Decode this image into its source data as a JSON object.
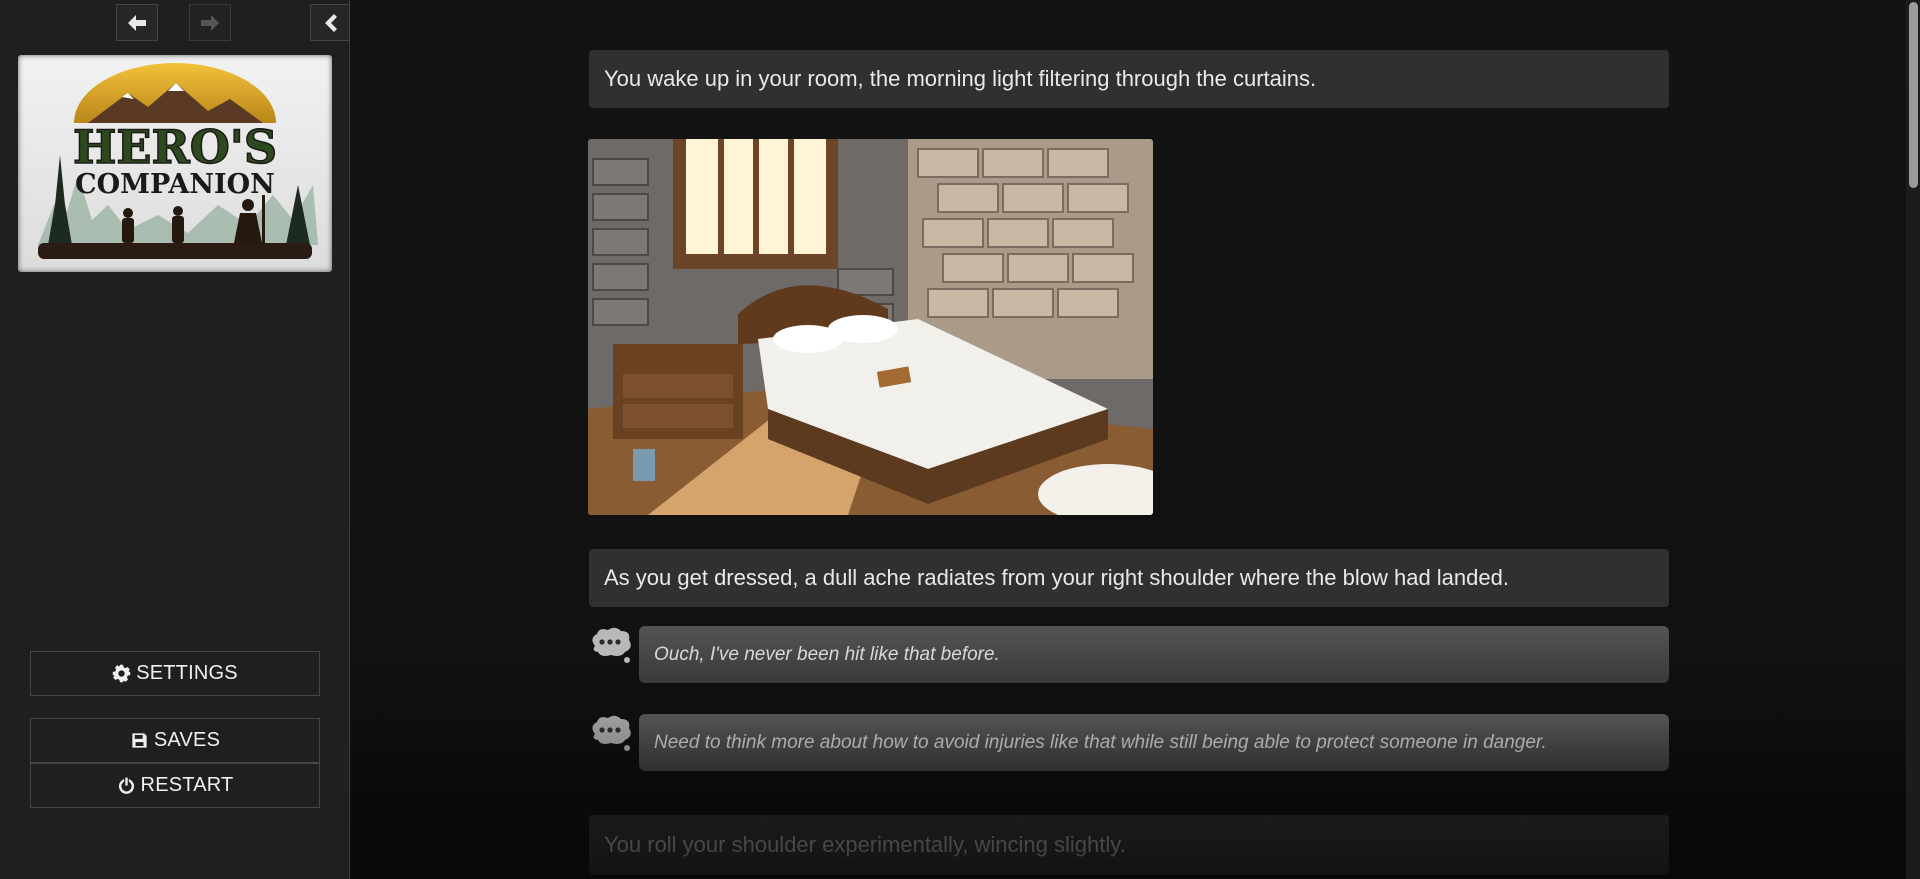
{
  "sidebar": {
    "back_icon": "arrow-left-icon",
    "forward_icon": "arrow-right-icon",
    "collapse_icon": "chevron-left-icon",
    "logo": {
      "line1": "HERO'S",
      "line2": "COMPANION"
    },
    "buttons": {
      "settings": "SETTINGS",
      "saves": "SAVES",
      "restart": "RESTART"
    }
  },
  "story": {
    "passages": [
      "You wake up in your room, the morning light filtering through the curtains.",
      "As you get dressed, a dull ache radiates from your right shoulder where the blow had landed.",
      "You roll your shoulder experimentally, wincing slightly."
    ],
    "thoughts": [
      "Ouch, I've never been hit like that before.",
      "Need to think more about how to avoid injuries like that while still being able to protect someone in danger."
    ]
  },
  "colors": {
    "sidebar_bg": "#1f1f1f",
    "story_bg": "#131313",
    "passage_bg": "#303030",
    "thought_bg": "#4a4a4a"
  }
}
